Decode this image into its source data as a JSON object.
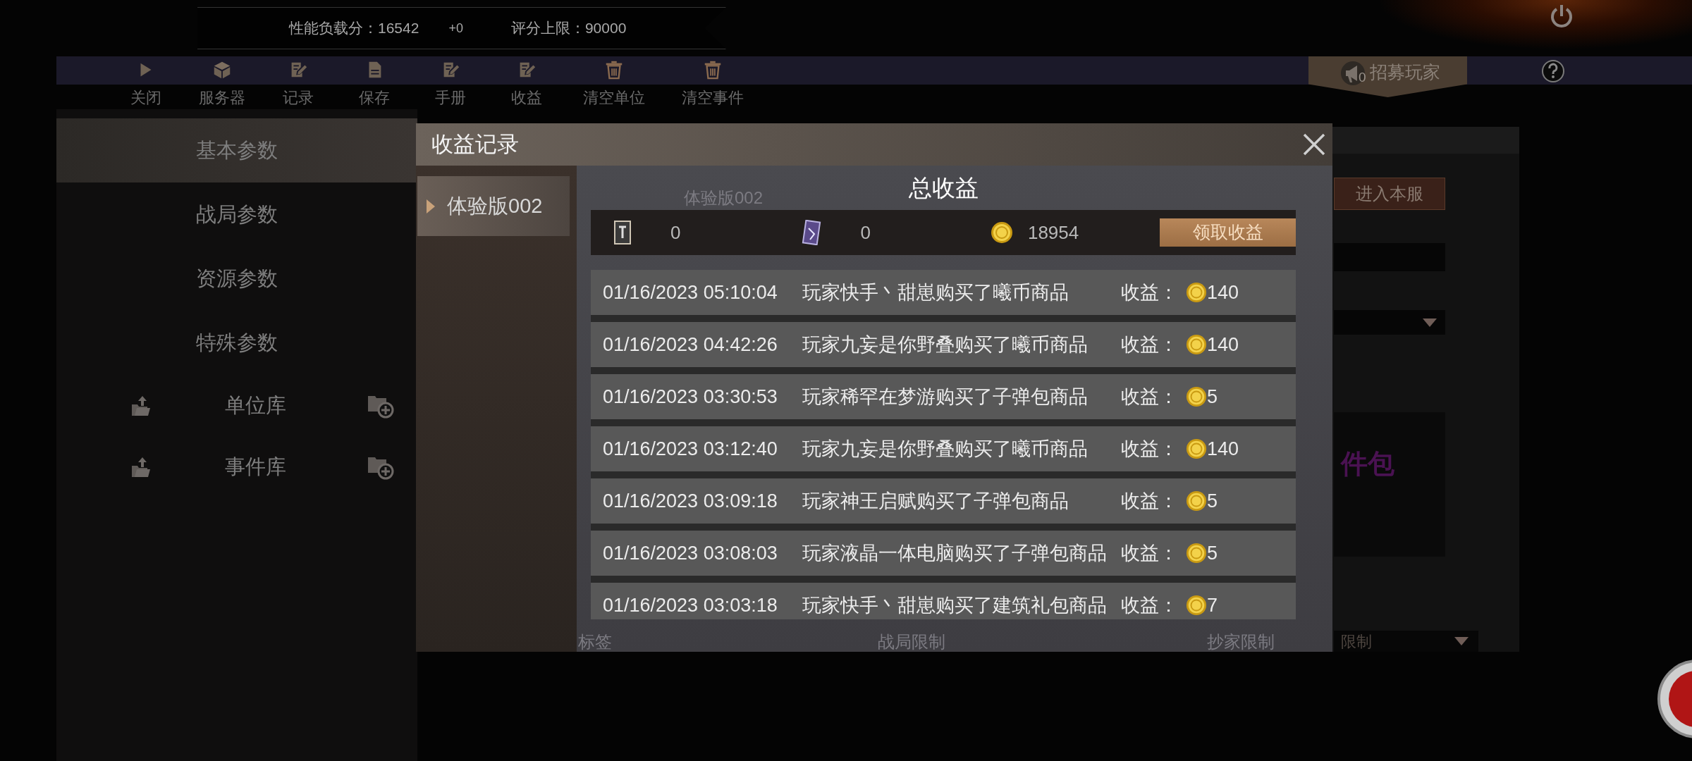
{
  "top_bar": {
    "load_score": "性能负载分：16542",
    "delta": "+0",
    "score_limit": "评分上限：90000"
  },
  "toolbar": [
    {
      "kind": "play",
      "label": "关闭"
    },
    {
      "kind": "cube",
      "label": "服务器"
    },
    {
      "kind": "edit",
      "label": "记录"
    },
    {
      "kind": "save",
      "label": "保存"
    },
    {
      "kind": "edit",
      "label": "手册"
    },
    {
      "kind": "edit",
      "label": "收益"
    },
    {
      "kind": "trash",
      "label": "清空单位"
    },
    {
      "kind": "trash",
      "label": "清空事件"
    }
  ],
  "recruit_button": {
    "label": "招募玩家",
    "badge": "0"
  },
  "sidebar": {
    "items": [
      {
        "label": "基本参数",
        "selected": true
      },
      {
        "label": "战局参数",
        "selected": false
      },
      {
        "label": "资源参数",
        "selected": false
      },
      {
        "label": "特殊参数",
        "selected": false
      }
    ],
    "libraries": [
      {
        "label": "单位库"
      },
      {
        "label": "事件库"
      }
    ]
  },
  "background_form": {
    "server_name": "体验版002",
    "enter_button": "进入本服",
    "pack_text": "件包",
    "bottom_labels": [
      "标签",
      "战局限制",
      "抄家限制"
    ],
    "limit_value": "限制"
  },
  "modal": {
    "title": "收益记录",
    "tabs": [
      {
        "label": "体验版002",
        "selected": true
      }
    ],
    "heading": "总收益",
    "totals": [
      {
        "kind": "card",
        "value": "0"
      },
      {
        "kind": "crystal",
        "value": "0"
      },
      {
        "kind": "coin",
        "value": "18954"
      }
    ],
    "claim_button": "领取收益",
    "records": [
      {
        "time": "01/16/2023 05:10:04",
        "text": "玩家快手丶甜崽购买了曦币商品",
        "income_label": "收益：",
        "amount": "140"
      },
      {
        "time": "01/16/2023 04:42:26",
        "text": "玩家九妄是你野叠购买了曦币商品",
        "income_label": "收益：",
        "amount": "140"
      },
      {
        "time": "01/16/2023 03:30:53",
        "text": "玩家稀罕在梦游购买了子弹包商品",
        "income_label": "收益：",
        "amount": "5"
      },
      {
        "time": "01/16/2023 03:12:40",
        "text": "玩家九妄是你野叠购买了曦币商品",
        "income_label": "收益：",
        "amount": "140"
      },
      {
        "time": "01/16/2023 03:09:18",
        "text": "玩家神王启赋购买了子弹包商品",
        "income_label": "收益：",
        "amount": "5"
      },
      {
        "time": "01/16/2023 03:08:03",
        "text": "玩家液晶一体电脑购买了子弹包商品",
        "income_label": "收益：",
        "amount": "5"
      },
      {
        "time": "01/16/2023 03:03:18",
        "text": "玩家快手丶甜崽购买了建筑礼包商品",
        "income_label": "收益：",
        "amount": "7"
      }
    ]
  }
}
